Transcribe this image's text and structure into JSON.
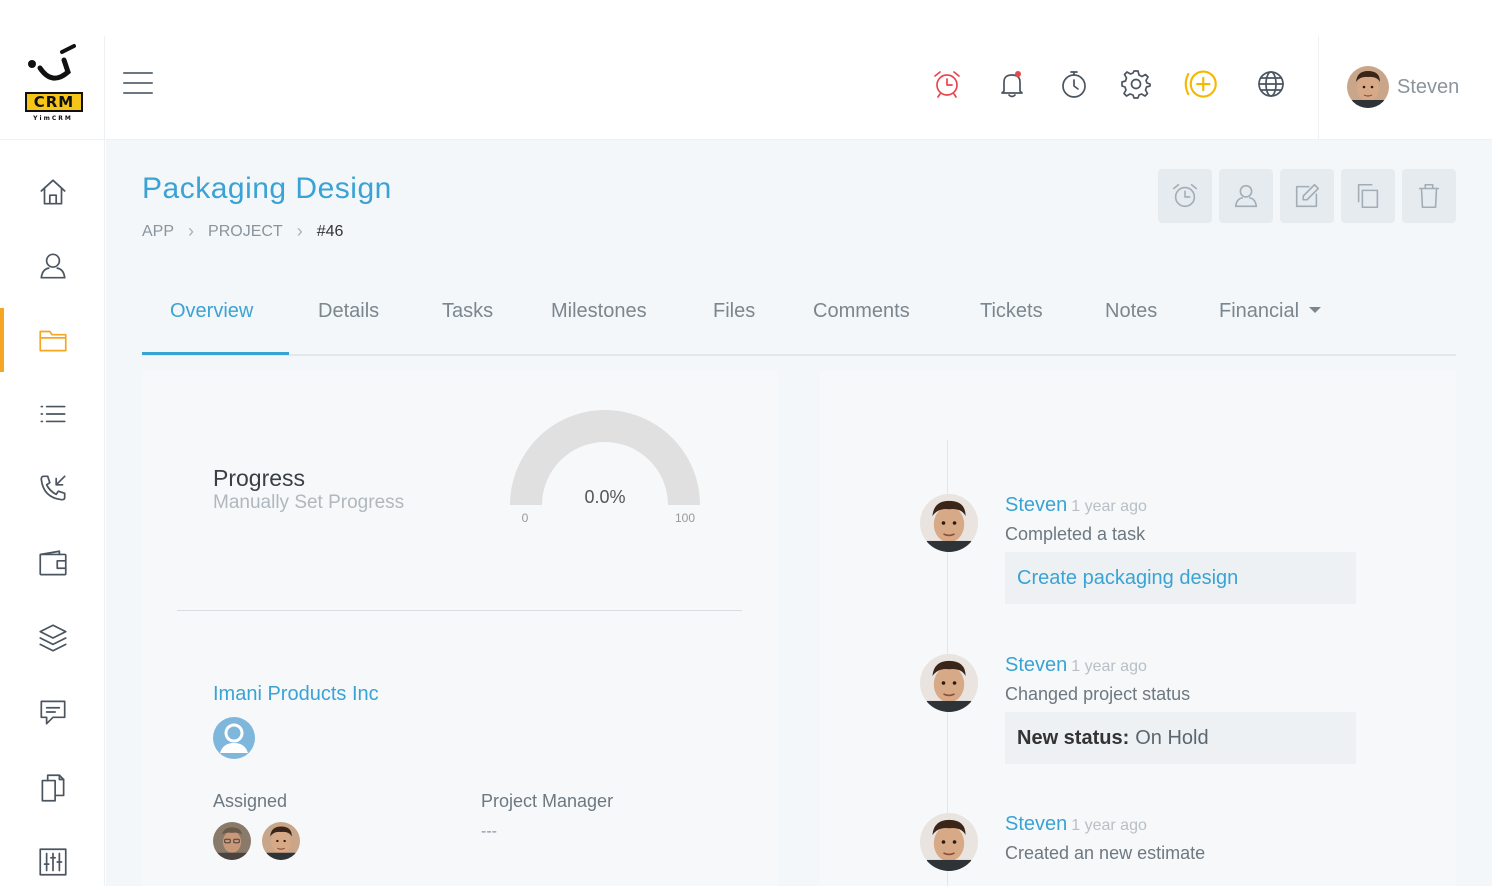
{
  "app": {
    "logo_text": "CRM",
    "logo_subtext": "YimCRM"
  },
  "topbar": {
    "user_name": "Steven"
  },
  "sidebar": {
    "items": [
      {
        "name": "home",
        "icon": "home-icon"
      },
      {
        "name": "clients",
        "icon": "user-icon"
      },
      {
        "name": "projects",
        "icon": "folder-icon",
        "active": true
      },
      {
        "name": "tasks",
        "icon": "list-icon"
      },
      {
        "name": "calls",
        "icon": "phone-icon"
      },
      {
        "name": "finance",
        "icon": "wallet-icon"
      },
      {
        "name": "layers",
        "icon": "layers-icon"
      },
      {
        "name": "messages",
        "icon": "chat-icon"
      },
      {
        "name": "documents",
        "icon": "documents-icon"
      },
      {
        "name": "settings",
        "icon": "sliders-icon"
      }
    ]
  },
  "page": {
    "title": "Packaging Design",
    "breadcrumb": [
      "APP",
      "PROJECT",
      "#46"
    ]
  },
  "tabs": [
    {
      "label": "Overview",
      "active": true
    },
    {
      "label": "Details"
    },
    {
      "label": "Tasks"
    },
    {
      "label": "Milestones"
    },
    {
      "label": "Files"
    },
    {
      "label": "Comments"
    },
    {
      "label": "Tickets"
    },
    {
      "label": "Notes"
    },
    {
      "label": "Financial",
      "dropdown": true
    }
  ],
  "overview": {
    "progress_title": "Progress",
    "progress_subtitle": "Manually Set Progress",
    "gauge": {
      "value_text": "0.0%",
      "value": 0,
      "min_label": "0",
      "max_label": "100"
    },
    "company": "Imani Products Inc",
    "assigned_label": "Assigned",
    "project_manager_label": "Project Manager",
    "project_manager_value": "---"
  },
  "timeline": [
    {
      "user": "Steven",
      "time": "1 year ago",
      "action": "Completed a task",
      "detail": "Create packaging design",
      "type": "link"
    },
    {
      "user": "Steven",
      "time": "1 year ago",
      "action": "Changed project status",
      "detail_label": "New status:",
      "detail": "On Hold",
      "type": "status"
    },
    {
      "user": "Steven",
      "time": "1 year ago",
      "action": "Created an new estimate"
    }
  ],
  "colors": {
    "accent": "#3aa3d5",
    "sidebar_active": "#f5a623",
    "alarm_icon": "#e8464e",
    "add_icon": "#f5b800"
  }
}
